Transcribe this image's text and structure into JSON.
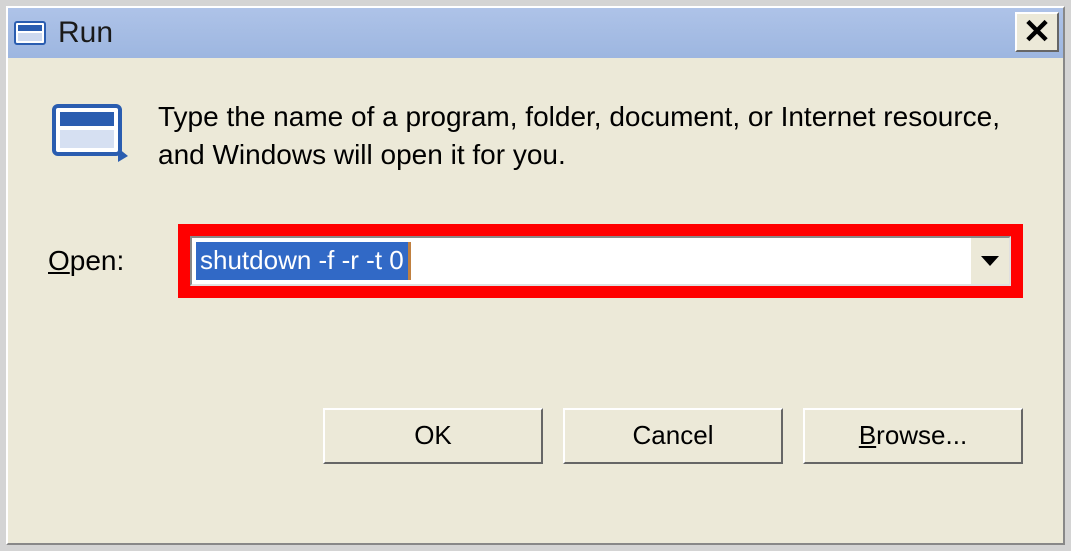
{
  "window": {
    "title": "Run",
    "close_glyph": "✕"
  },
  "content": {
    "instruction": "Type the name of a program, folder, document, or Internet resource, and Windows will open it for you.",
    "open_label_underlined_char": "O",
    "open_label_rest": "pen:",
    "command_value": "shutdown -f -r -t 0"
  },
  "buttons": {
    "ok": "OK",
    "cancel": "Cancel",
    "browse_underlined_char": "B",
    "browse_rest": "rowse..."
  }
}
